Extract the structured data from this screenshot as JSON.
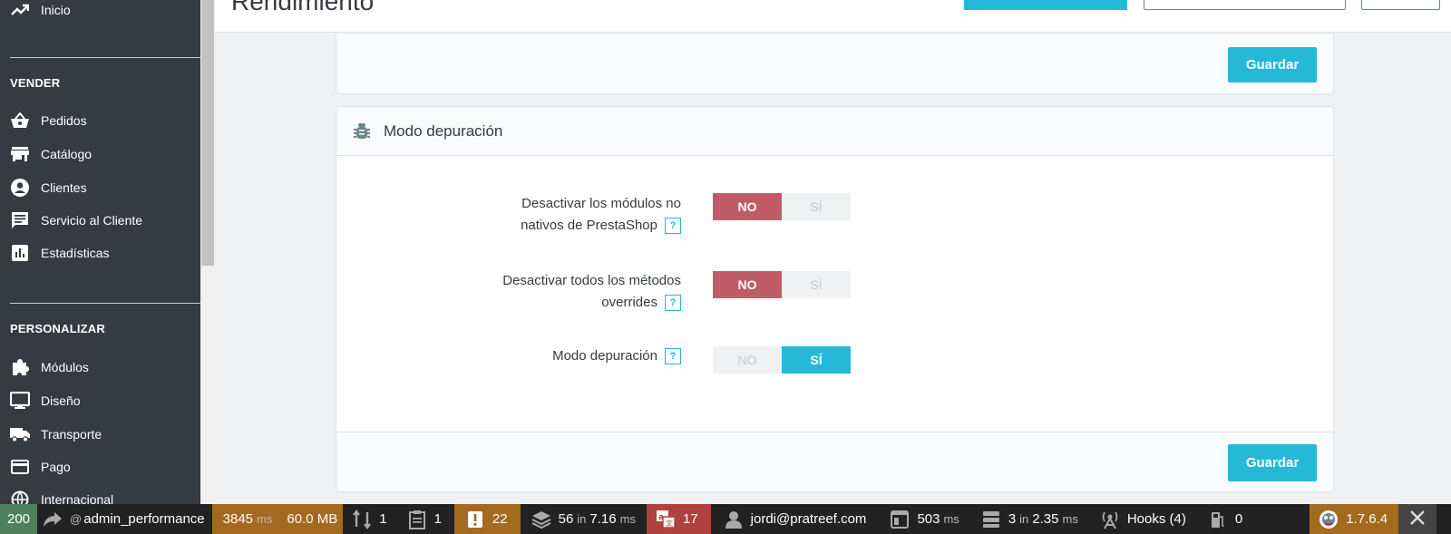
{
  "sidebar": {
    "top_item": {
      "label": "Inicio",
      "icon": "trending-up-icon"
    },
    "section_vender": "VENDER",
    "vender_items": [
      {
        "label": "Pedidos",
        "icon": "basket-icon"
      },
      {
        "label": "Catálogo",
        "icon": "store-icon"
      },
      {
        "label": "Clientes",
        "icon": "account-circle-icon"
      },
      {
        "label": "Servicio al Cliente",
        "icon": "chat-icon"
      },
      {
        "label": "Estadísticas",
        "icon": "bar-chart-icon"
      }
    ],
    "section_personalizar": "PERSONALIZAR",
    "personalizar_items": [
      {
        "label": "Módulos",
        "icon": "puzzle-icon"
      },
      {
        "label": "Diseño",
        "icon": "monitor-icon"
      },
      {
        "label": "Transporte",
        "icon": "truck-icon"
      },
      {
        "label": "Pago",
        "icon": "credit-card-icon"
      },
      {
        "label": "Internacional",
        "icon": "globe-icon"
      }
    ]
  },
  "header": {
    "title": "Rendimiento"
  },
  "top_panel": {
    "save_label": "Guardar"
  },
  "debug_panel": {
    "title": "Modo depuración",
    "icon": "bug-icon",
    "rows": [
      {
        "label_line1": "Desactivar los módulos no",
        "label_line2": "nativos de PrestaShop",
        "help": "?",
        "no": "NO",
        "si": "SÍ",
        "selected": "NO"
      },
      {
        "label_line1": "Desactivar todos los métodos",
        "label_line2": "overrides",
        "help": "?",
        "no": "NO",
        "si": "SÍ",
        "selected": "NO"
      },
      {
        "label_line1": "Modo depuración",
        "label_line2": "",
        "help": "?",
        "no": "NO",
        "si": "SÍ",
        "selected": "SÍ"
      }
    ],
    "save_label": "Guardar"
  },
  "toolbar": {
    "status": "200",
    "route_prefix": "@",
    "route": "admin_performance",
    "time_value": "3845",
    "time_unit": "ms",
    "memory": "60.0 MB",
    "forms": "1",
    "templates": "1",
    "logs": "22",
    "queries_count": "56",
    "queries_in": "in",
    "queries_time": "7.16",
    "queries_unit": "ms",
    "translations": "17",
    "user": "jordi@pratreef.com",
    "render_time": "503",
    "render_unit": "ms",
    "cache_count": "3",
    "cache_in": "in",
    "cache_time": "2.35",
    "cache_unit": "ms",
    "hooks": "Hooks (4)",
    "gas": "0",
    "version": "1.7.6.4",
    "colors": {
      "status_bg": "#4f805d",
      "time_bg": "#a46a1f",
      "logs_bg": "#a46a1f",
      "translations_bg": "#b0413e",
      "version_bg": "#a46a1f"
    }
  }
}
